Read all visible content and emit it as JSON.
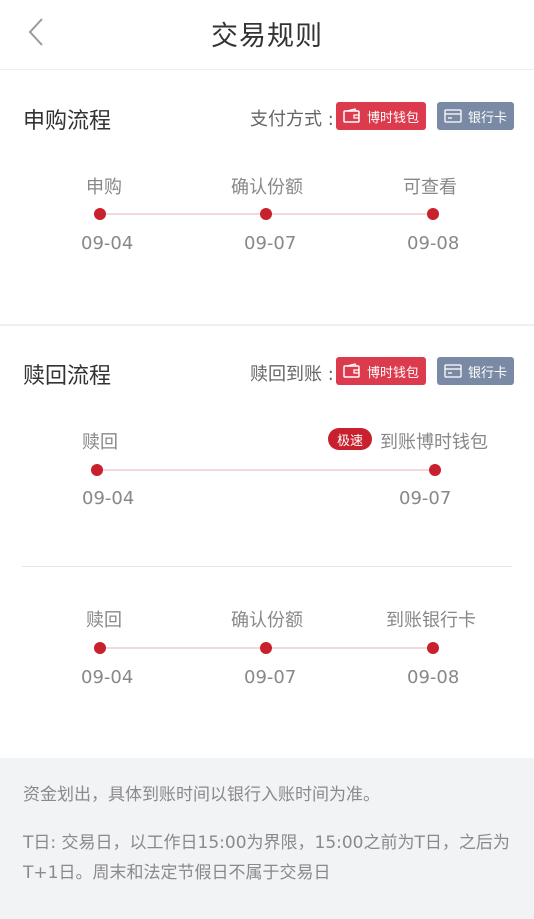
{
  "header": {
    "title": "交易规则"
  },
  "purchase": {
    "title": "申购流程",
    "payment_label": "支付方式 :",
    "badges": [
      "博时钱包",
      "银行卡"
    ],
    "steps": [
      {
        "label": "申购",
        "date": "09-04"
      },
      {
        "label": "确认份额",
        "date": "09-07"
      },
      {
        "label": "可查看",
        "date": "09-08"
      }
    ]
  },
  "redeem": {
    "title": "赎回流程",
    "arrival_label": "赎回到账 :",
    "badges": [
      "博时钱包",
      "银行卡"
    ],
    "fast": {
      "tag": "极速",
      "steps": [
        {
          "label": "赎回",
          "date": "09-04"
        },
        {
          "label": "到账博时钱包",
          "date": "09-07"
        }
      ]
    },
    "normal": {
      "steps": [
        {
          "label": "赎回",
          "date": "09-04"
        },
        {
          "label": "确认份额",
          "date": "09-07"
        },
        {
          "label": "到账银行卡",
          "date": "09-08"
        }
      ]
    }
  },
  "notes": {
    "line1": "资金划出，具体到账时间以银行入账时间为准。",
    "line2": "T日: 交易日，以工作日15:00为界限，15:00之前为T日，之后为T+1日。周末和法定节假日不属于交易日"
  },
  "colors": {
    "accent": "#c8202c",
    "badge_red": "#db3b4d",
    "badge_gray": "#7b8aa4",
    "track": "#f3d9dc"
  }
}
